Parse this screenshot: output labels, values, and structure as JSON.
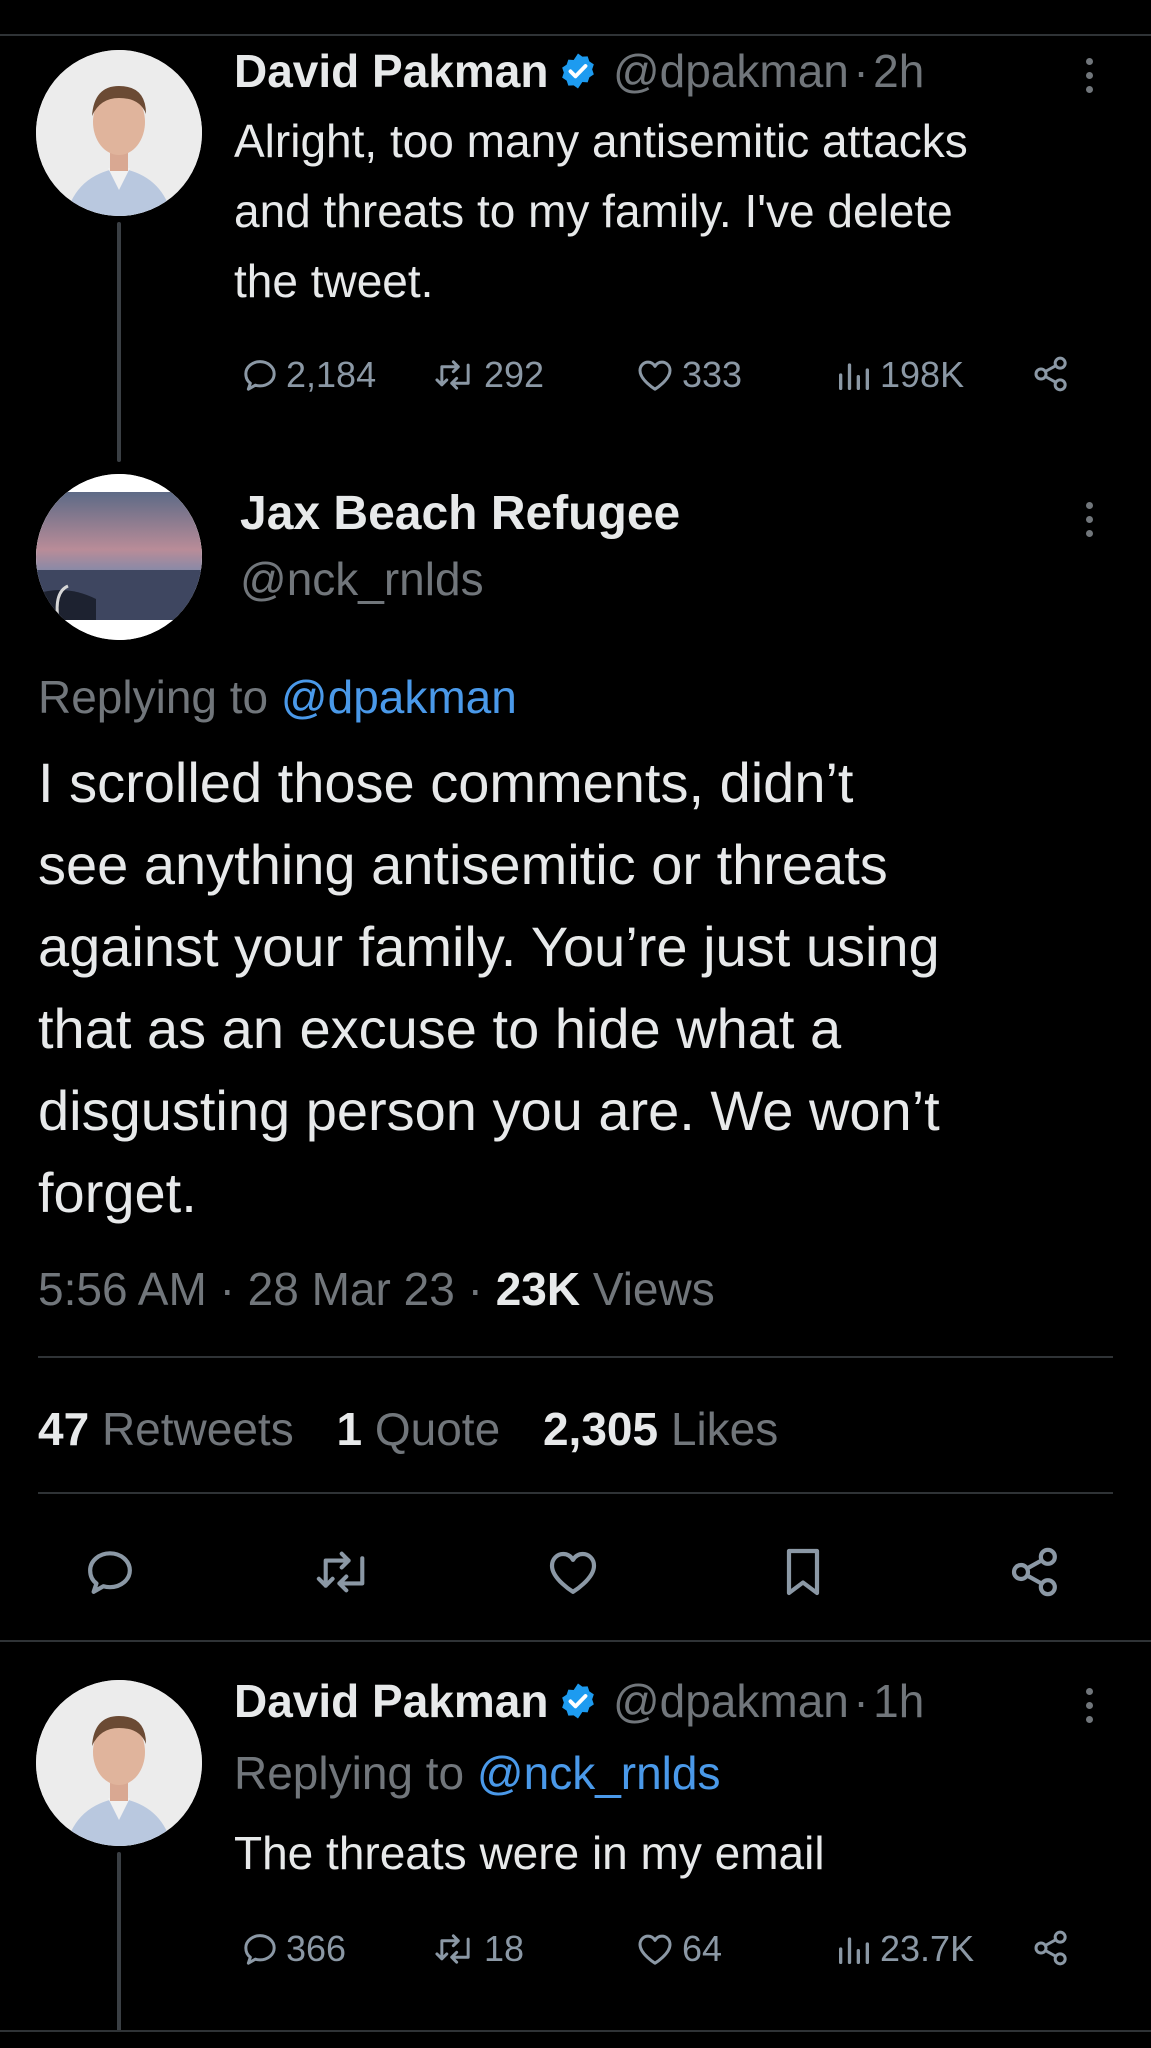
{
  "tweet1": {
    "name": "David Pakman",
    "handle": "@dpakman",
    "sep": "·",
    "time": "2h",
    "text_lines": [
      "Alright, too many antisemitic attacks",
      "and threats to my family. I've delete",
      "the tweet."
    ],
    "replies": "2,184",
    "retweets": "292",
    "likes": "333",
    "views": "198K"
  },
  "main_tweet": {
    "name": "Jax Beach Refugee",
    "handle": "@nck_rnlds",
    "replying_prefix": "Replying to",
    "replying_to": "@dpakman",
    "text_lines": [
      "I scrolled those comments, didn’t",
      "see anything antisemitic or threats",
      "against your family.  You’re just using",
      "that as an excuse to hide what a",
      "disgusting person you are.  We won’t",
      "forget."
    ],
    "time": "5:56 AM",
    "date": "28 Mar 23",
    "views_count": "23K",
    "views_label": "Views",
    "retweets_count": "47",
    "retweets_label": "Retweets",
    "quotes_count": "1",
    "quotes_label": "Quote",
    "likes_count": "2,305",
    "likes_label": "Likes"
  },
  "tweet3": {
    "name": "David Pakman",
    "handle": "@dpakman",
    "sep": "·",
    "time": "1h",
    "replying_prefix": "Replying to",
    "replying_to": "@nck_rnlds",
    "text": "The threats were in my email",
    "replies": "366",
    "retweets": "18",
    "likes": "64",
    "views": "23.7K"
  },
  "icons": {
    "reply": "reply-icon",
    "retweet": "retweet-icon",
    "like": "heart-icon",
    "views": "views-icon",
    "share": "share-icon",
    "bookmark": "bookmark-icon",
    "verified": "verified-badge-icon",
    "more": "more-icon"
  },
  "colors": {
    "background": "#000000",
    "text": "#e7e9ea",
    "secondary": "#71767b",
    "link": "#4a99e9",
    "verified": "#1d9bf0",
    "divider": "#2f3336"
  }
}
